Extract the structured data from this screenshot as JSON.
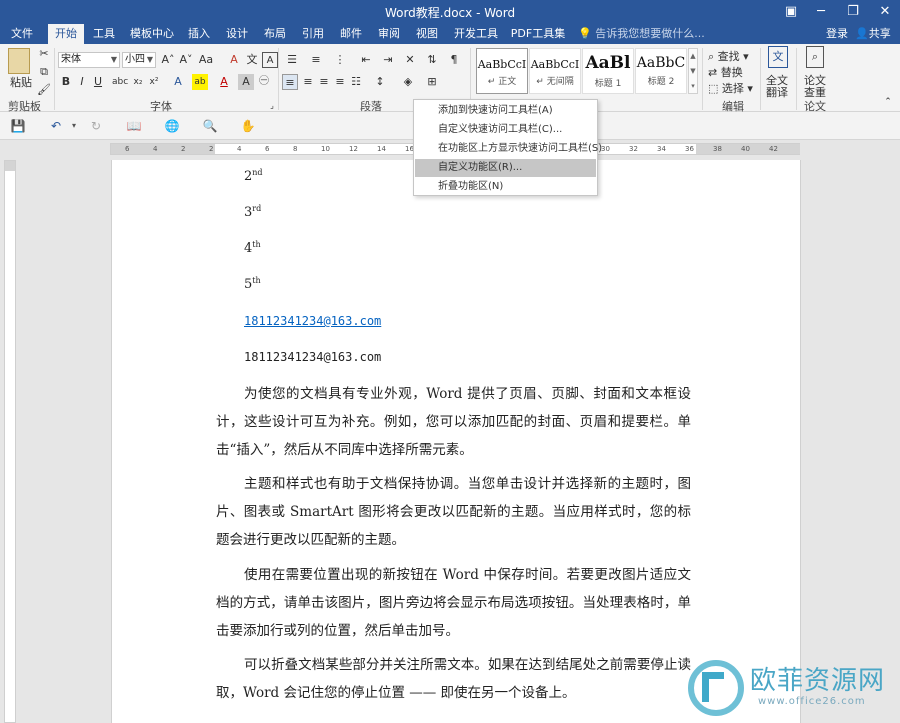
{
  "window": {
    "title": "Word教程.docx - Word",
    "min": "─",
    "restore": "❐",
    "close": "✕",
    "ribbon_opts": "▣"
  },
  "tabs": [
    {
      "label": "文件"
    },
    {
      "label": "开始"
    },
    {
      "label": "工具"
    },
    {
      "label": "模板中心"
    },
    {
      "label": "插入"
    },
    {
      "label": "设计"
    },
    {
      "label": "布局"
    },
    {
      "label": "引用"
    },
    {
      "label": "邮件"
    },
    {
      "label": "审阅"
    },
    {
      "label": "视图"
    },
    {
      "label": "开发工具"
    },
    {
      "label": "PDF工具集"
    }
  ],
  "tellme": "告诉我您想要做什么...",
  "login": "登录",
  "share": "共享",
  "ribbon": {
    "clipboard": {
      "paste": "粘贴",
      "label": "剪贴板"
    },
    "font": {
      "name": "宋体",
      "size": "小四",
      "label": "字体"
    },
    "paragraph": {
      "label": "段落"
    },
    "styles": [
      {
        "sample": "AaBbCcI",
        "name": "↵ 正文"
      },
      {
        "sample": "AaBbCcI",
        "name": "↵ 无间隔"
      },
      {
        "sample": "AaBl",
        "name": "标题 1"
      },
      {
        "sample": "AaBbC",
        "name": "标题 2"
      }
    ],
    "editing": {
      "find": "查找",
      "replace": "替换",
      "select": "选择",
      "label": "编辑"
    },
    "translate": {
      "label1": "全文",
      "label2": "翻译"
    },
    "paper": {
      "label1": "论文",
      "label2": "查重",
      "group": "论文"
    }
  },
  "context_menu": [
    "添加到快速访问工具栏(A)",
    "自定义快速访问工具栏(C)...",
    "在功能区上方显示快速访问工具栏(S)",
    "自定义功能区(R)...",
    "折叠功能区(N)"
  ],
  "document": {
    "ordinals": [
      {
        "num": "2",
        "sup": "nd"
      },
      {
        "num": "3",
        "sup": "rd"
      },
      {
        "num": "4",
        "sup": "th"
      },
      {
        "num": "5",
        "sup": "th"
      }
    ],
    "email_link": "18112341234@163.com",
    "email_plain": "18112341234@163.com",
    "paragraphs": [
      "为使您的文档具有专业外观，Word 提供了页眉、页脚、封面和文本框设计，这些设计可互为补充。例如，您可以添加匹配的封面、页眉和提要栏。单击“插入”，然后从不同库中选择所需元素。",
      "主题和样式也有助于文档保持协调。当您单击设计并选择新的主题时，图片、图表或 SmartArt 图形将会更改以匹配新的主题。当应用样式时，您的标题会进行更改以匹配新的主题。",
      "使用在需要位置出现的新按钮在 Word 中保存时间。若要更改图片适应文档的方式，请单击该图片，图片旁边将会显示布局选项按钮。当处理表格时，单击要添加行或列的位置，然后单击加号。",
      "可以折叠文档某些部分并关注所需文本。如果在达到结尾处之前需要停止读取，Word 会记住您的停止位置 —— 即使在另一个设备上。"
    ]
  },
  "ruler_ticks": [
    "6",
    "4",
    "2",
    "2",
    "4",
    "6",
    "8",
    "10",
    "12",
    "14",
    "16",
    "18",
    "20",
    "22",
    "24",
    "26",
    "28",
    "30",
    "32",
    "34",
    "36",
    "38",
    "40",
    "42"
  ],
  "watermark": {
    "title": "欧菲资源网",
    "url": "www.office26.com"
  }
}
